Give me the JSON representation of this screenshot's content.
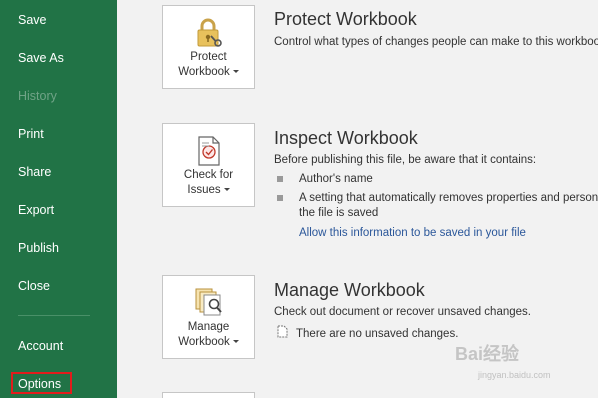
{
  "sidebar": {
    "items": [
      {
        "label": "Save"
      },
      {
        "label": "Save As"
      },
      {
        "label": "History"
      },
      {
        "label": "Print"
      },
      {
        "label": "Share"
      },
      {
        "label": "Export"
      },
      {
        "label": "Publish"
      },
      {
        "label": "Close"
      },
      {
        "label": "Account"
      },
      {
        "label": "Options"
      }
    ]
  },
  "sections": {
    "protect": {
      "icon": "lock-icon",
      "button_line1": "Protect",
      "button_line2": "Workbook",
      "title": "Protect Workbook",
      "description": "Control what types of changes people can make to this workbook."
    },
    "inspect": {
      "icon": "inspect-document-icon",
      "button_line1": "Check for",
      "button_line2": "Issues",
      "title": "Inspect Workbook",
      "description": "Before publishing this file, be aware that it contains:",
      "bullets": [
        {
          "line1": "Author's name",
          "line2": ""
        },
        {
          "line1": "A setting that automatically removes properties and personal information when",
          "line2": "the file is saved"
        }
      ],
      "link": "Allow this information to be saved in your file"
    },
    "manage": {
      "icon": "manage-versions-icon",
      "button_line1": "Manage",
      "button_line2": "Workbook",
      "title": "Manage Workbook",
      "description": "Check out document or recover unsaved changes.",
      "status": "There are no unsaved changes."
    }
  },
  "watermark": {
    "text": "Bai经验",
    "sub": "jingyan.baidu.com"
  },
  "colors": {
    "sidebar_bg": "#217346",
    "link": "#2b579a",
    "highlight_border": "#e21c1c"
  }
}
